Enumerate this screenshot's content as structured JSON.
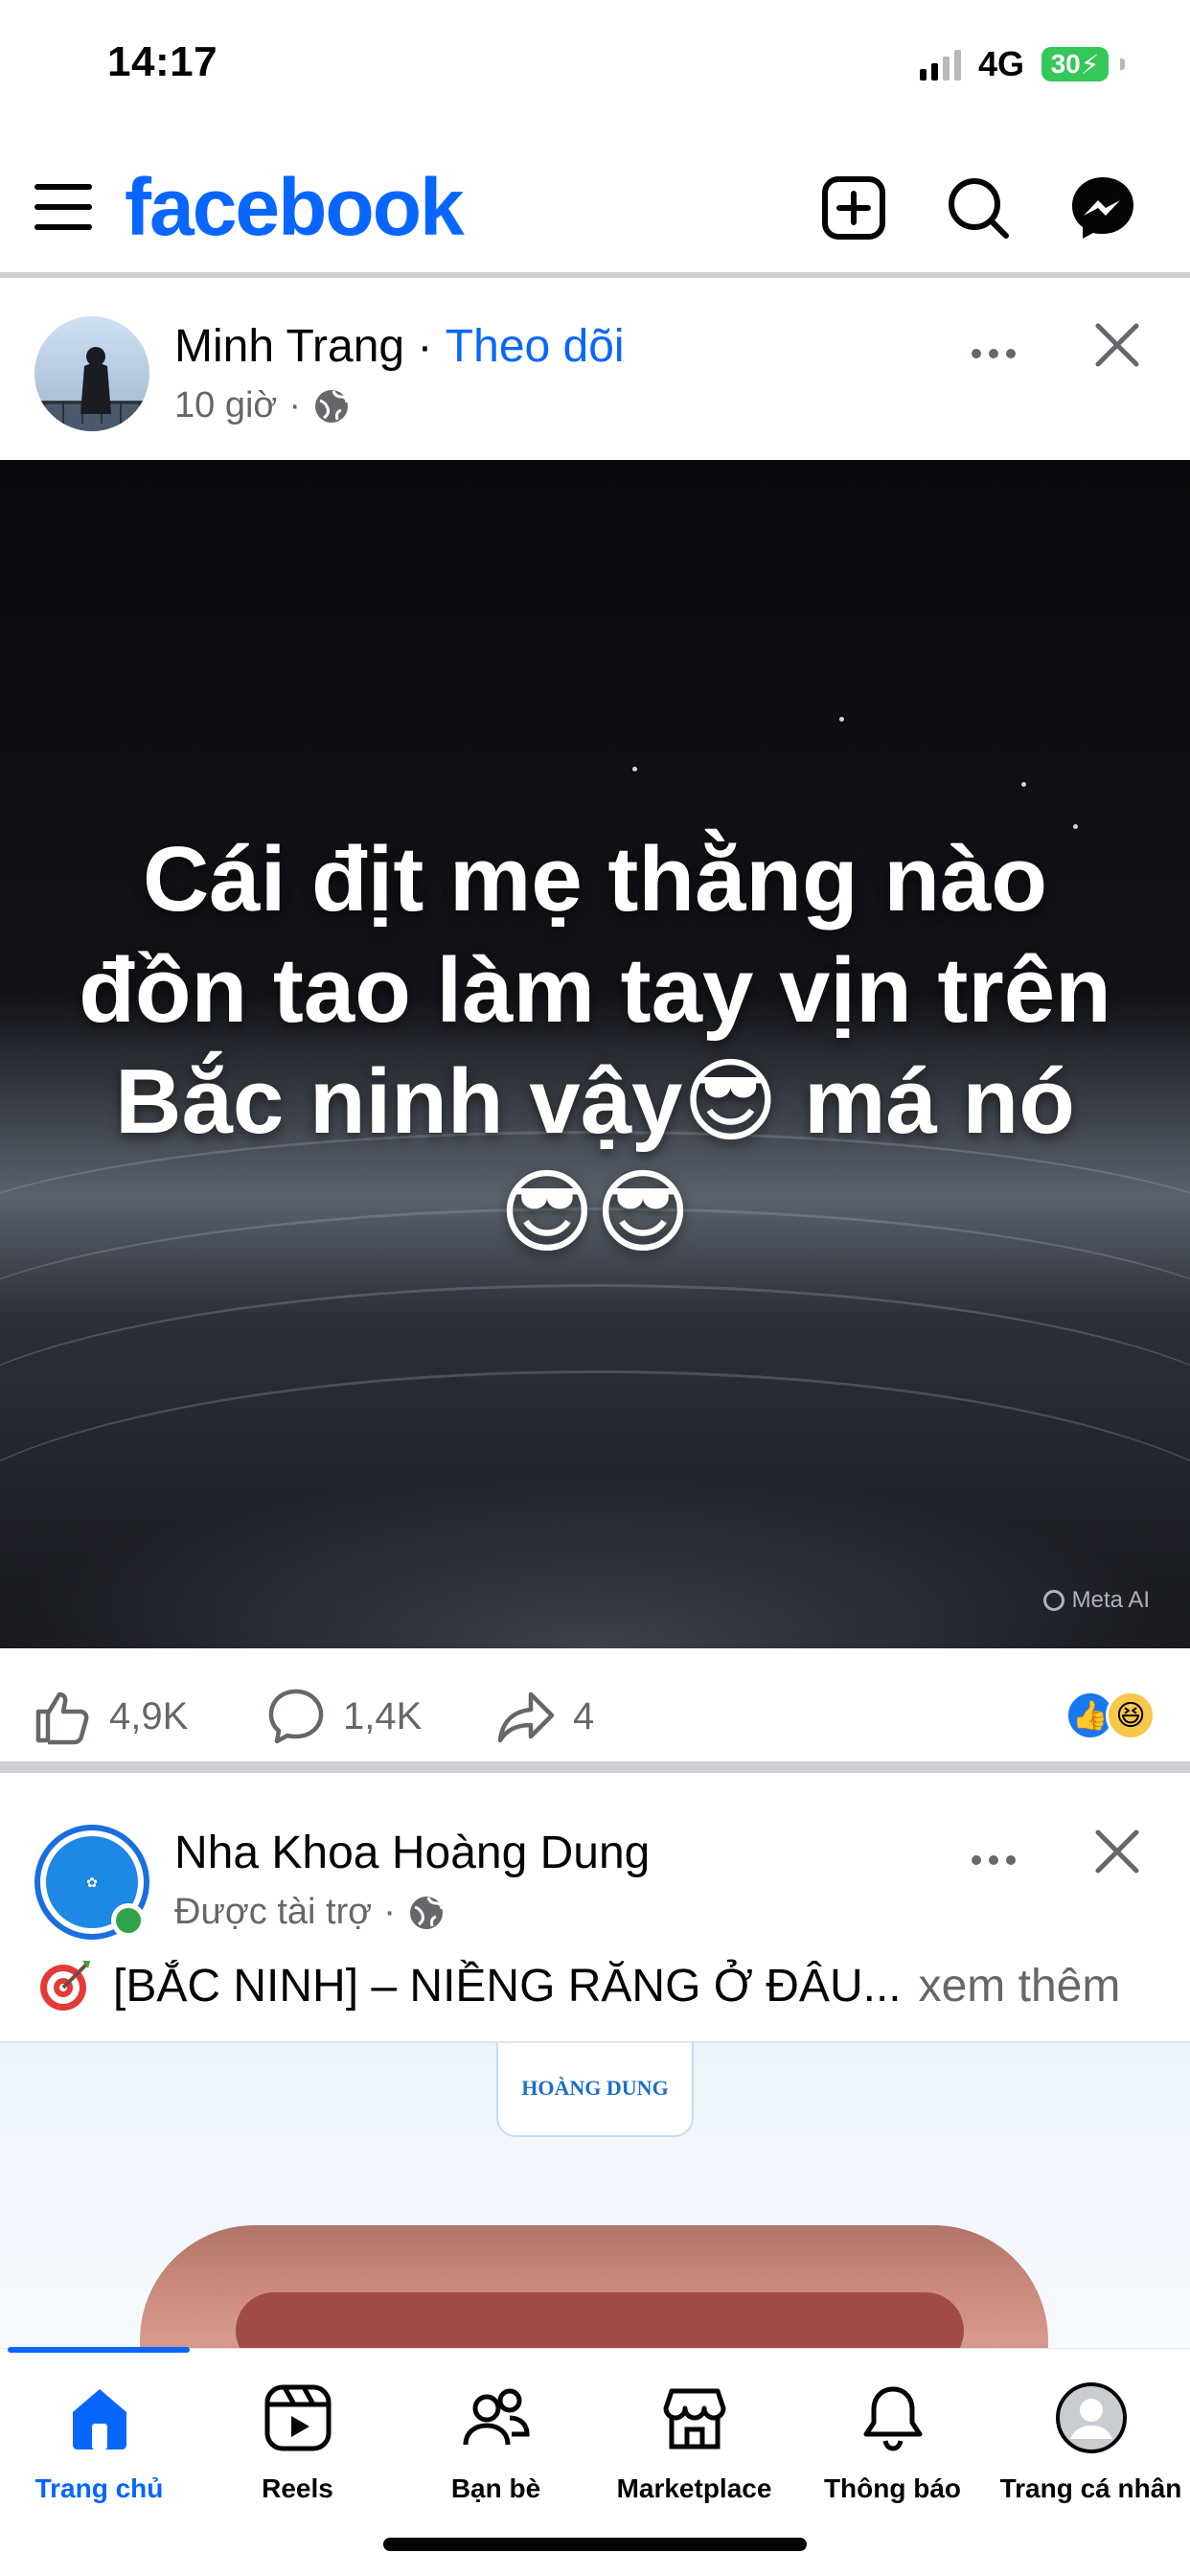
{
  "status_bar": {
    "time": "14:17",
    "network": "4G",
    "battery": "30"
  },
  "header": {
    "logo": "facebook"
  },
  "post": {
    "author": "Minh Trang",
    "separator": "·",
    "follow_label": "Theo dõi",
    "time": "10 giờ",
    "meta_dot": "·",
    "image_text": "Cái địt mẹ thằng nào đồn tao làm tay vịn trên Bắc ninh vậy😎 má nó 😎😎",
    "watermark": "Meta AI",
    "likes": "4,9K",
    "comments": "1,4K",
    "shares": "4"
  },
  "ad_post": {
    "author": "Nha Khoa Hoàng Dung",
    "sponsored": "Được tài trợ",
    "meta_dot": "·",
    "text": "[BẮC NINH] – NIỀNG RĂNG Ở ĐÂU...",
    "see_more": "xem thêm",
    "logo_text": "HOÀNG DUNG"
  },
  "bottom_nav": {
    "items": [
      {
        "label": "Trang chủ",
        "icon": "home-icon",
        "active": true
      },
      {
        "label": "Reels",
        "icon": "reels-icon",
        "active": false
      },
      {
        "label": "Bạn bè",
        "icon": "friends-icon",
        "active": false
      },
      {
        "label": "Marketplace",
        "icon": "marketplace-icon",
        "active": false
      },
      {
        "label": "Thông báo",
        "icon": "bell-icon",
        "active": false
      },
      {
        "label": "Trang cá nhân",
        "icon": "profile-icon",
        "active": false
      }
    ]
  },
  "colors": {
    "brand": "#0866ff",
    "secondary_text": "#65676b",
    "divider": "#ced0d4",
    "online": "#31a24c"
  }
}
